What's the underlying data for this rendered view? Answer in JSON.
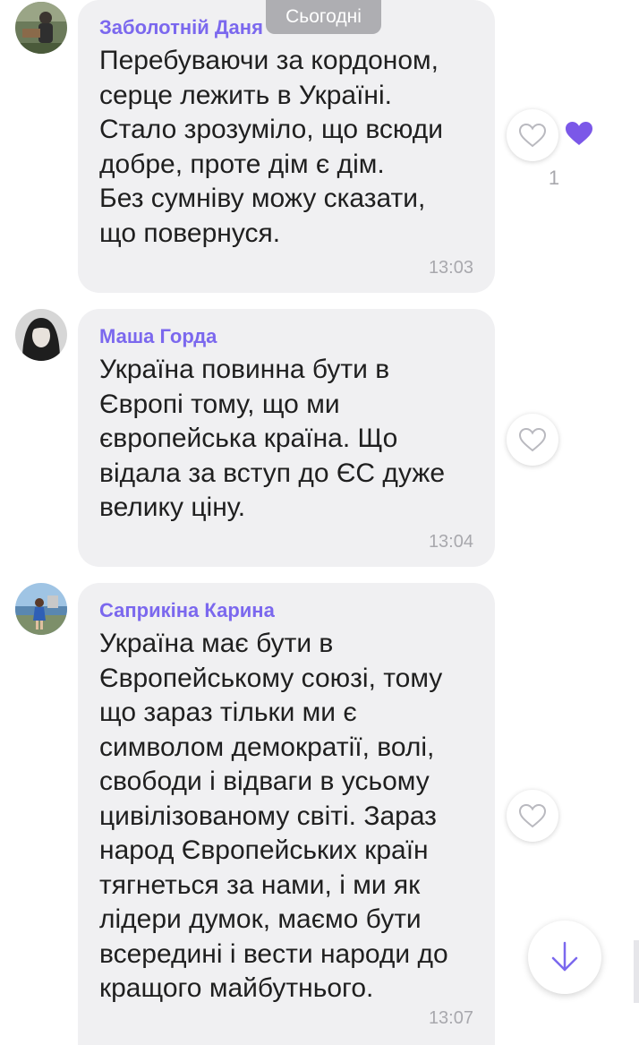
{
  "date_separator": "Сьогодні",
  "messages": [
    {
      "sender": "Заболотній Даня",
      "text": "Перебуваючи за кордоном,\nсерце лежить в Україні.\nСтало зрозуміло, що всюди\nдобре, проте дім є дім.\nБез сумніву можу сказати,\nщо повернуся.",
      "time": "13:03",
      "avatar": "avatar-photo",
      "reaction_icon": "heart-outline-icon",
      "liked_reaction_icon": "heart-filled-icon",
      "like_count": "1"
    },
    {
      "sender": "Маша Горда",
      "text": "Україна повинна бути в\nЄвропі тому, що ми\nєвропейська країна. Що\nвідала за вступ до ЄС дуже\nвелику ціну.",
      "time": "13:04",
      "avatar": "avatar-photo",
      "reaction_icon": "heart-outline-icon"
    },
    {
      "sender": "Саприкіна Карина",
      "text": "Україна має бути в\nЄвропейському союзі, тому\nщо зараз тільки ми є\nсимволом демократії, волі,\nсвободи і відваги в усьому\nцивілізованому світі. Зараз\nнарод Європейських країн\nтягнеться за нами, і ми як\nлідери думок, маємо бути\nвсередині і вести народи до\nкращого майбутнього.",
      "time": "13:07",
      "avatar": "avatar-photo",
      "reaction_icon": "heart-outline-icon"
    }
  ],
  "scroll_button_icon": "arrow-down-icon",
  "colors": {
    "sender_name": "#7b68ee",
    "bubble_bg": "#f0f0f2",
    "accent_heart": "#7b58e8",
    "timestamp": "#a8a8ad"
  }
}
